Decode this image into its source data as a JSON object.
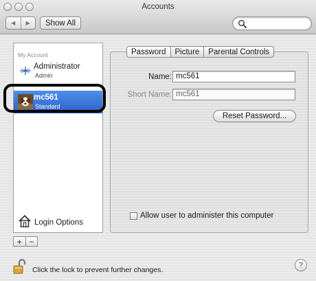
{
  "window": {
    "title": "Accounts",
    "buttons": [
      "close",
      "minimize",
      "zoom"
    ]
  },
  "toolbar": {
    "back_icon": "back-arrow-icon",
    "forward_icon": "forward-arrow-icon",
    "show_all_label": "Show All",
    "search_placeholder": ""
  },
  "sidebar": {
    "section_label": "My Account",
    "accounts": [
      {
        "name": "Administrator",
        "role": "Admin",
        "icon": "admin-user-icon",
        "selected": false
      },
      {
        "name": "mc561",
        "role": "Standard",
        "icon": "dog-picture-icon",
        "selected": true
      }
    ],
    "login_options_label": "Login Options",
    "add_label": "+",
    "remove_label": "−"
  },
  "tabs": [
    {
      "label": "Password",
      "active": true
    },
    {
      "label": "Picture",
      "active": false
    },
    {
      "label": "Parental Controls",
      "active": false
    }
  ],
  "form": {
    "name_label": "Name:",
    "name_value": "mc561",
    "short_name_label": "Short Name:",
    "short_name_value": "mc561",
    "reset_password_label": "Reset Password...",
    "allow_admin_label": "Allow user to administer this computer",
    "allow_admin_checked": false
  },
  "footer": {
    "lock_text": "Click the lock to prevent further changes.",
    "help_label": "?"
  },
  "colors": {
    "selection_blue": "#2b62c9",
    "annotation_ring": "#000000"
  }
}
